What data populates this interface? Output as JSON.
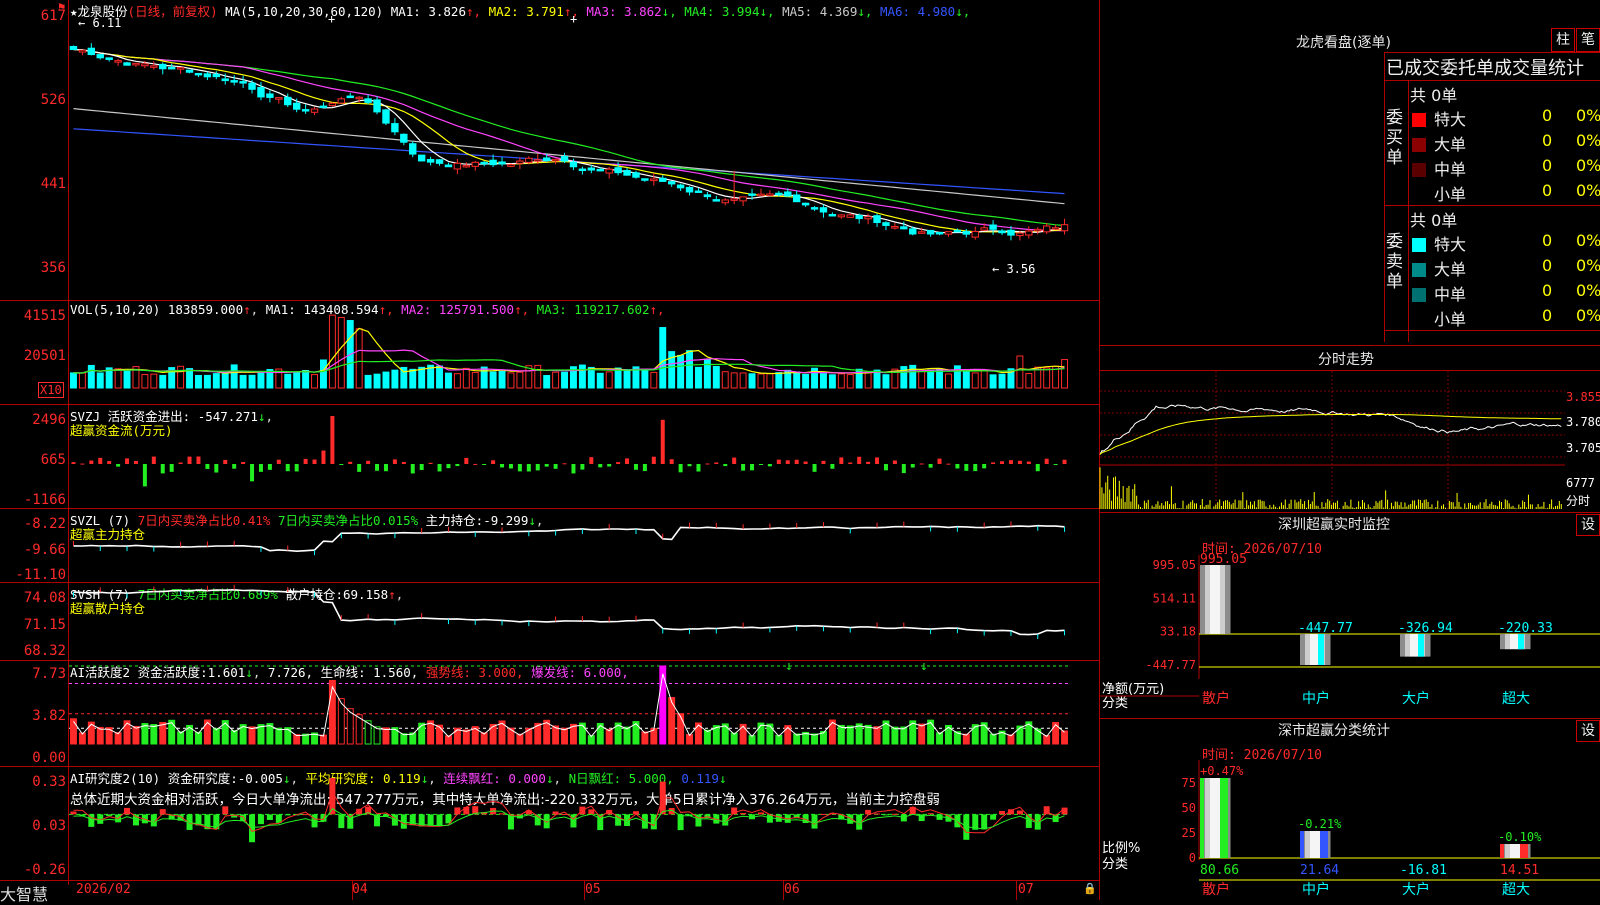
{
  "header": {
    "star": "★",
    "stock_name": "龙泉股份",
    "period": "(日线，前复权)",
    "ma_label": "MA(5,10,20,30,60,120)",
    "ma_items": [
      {
        "label": "MA1:",
        "value": "3.826",
        "arrow": "↑",
        "color": "#ffffff"
      },
      {
        "label": "MA2:",
        "value": "3.791",
        "arrow": "↑",
        "color": "#ffff00"
      },
      {
        "label": "MA3:",
        "value": "3.862",
        "arrow": "↓",
        "color": "#ff44ff"
      },
      {
        "label": "MA4:",
        "value": "3.994",
        "arrow": "↓",
        "color": "#22ee22"
      },
      {
        "label": "MA5:",
        "value": "4.369",
        "arrow": "↓",
        "color": "#c8c8c8"
      },
      {
        "label": "MA6:",
        "value": "4.980",
        "arrow": "↓",
        "color": "#3355ff"
      }
    ],
    "high_label": "6.11",
    "low_label": "3.56"
  },
  "price_axis": [
    "617",
    "526",
    "441",
    "356"
  ],
  "vol": {
    "legend": "VOL(5,10,20)",
    "value": "183859.000",
    "items": [
      {
        "label": "MA1:",
        "value": "143408.594",
        "color": "#ffffff"
      },
      {
        "label": "MA2:",
        "value": "125791.500",
        "color": "#ff44ff"
      },
      {
        "label": "MA3:",
        "value": "119217.602",
        "color": "#22ee22"
      }
    ],
    "axis": [
      "41515",
      "20501"
    ],
    "unit": "X10"
  },
  "svzj": {
    "legend": "SVZJ  活跃资金进出:",
    "value": "-547.271",
    "sub": "超赢资金流(万元)",
    "axis": [
      "2496",
      "665",
      "-1166"
    ]
  },
  "svzl": {
    "name": "SVZL (7)",
    "p1": "7日内买卖净占比0.41%",
    "p2": "7日内买卖净占比0.015%",
    "p3": "主力持仓:",
    "p3v": "-9.299",
    "sub": "超赢主力持仓",
    "axis": [
      "-8.22",
      "-9.66",
      "-11.10"
    ]
  },
  "svsh": {
    "name": "SVSH (7)",
    "p1": "7日内买卖净占比0.689%",
    "p2": "散户持仓:",
    "p2v": "69.158",
    "sub": "超赢散户持仓",
    "axis": [
      "74.08",
      "71.15",
      "68.32"
    ]
  },
  "ai1": {
    "name": "AI活跃度2",
    "label": "资金活跃度:",
    "v1": "1.601",
    "v2": "7.726,",
    "life": "生命线: 1.560,",
    "strong": "强势线: 3.000,",
    "burst": "爆发线: 6.000,",
    "axis": [
      "7.73",
      "3.82",
      "0.00"
    ]
  },
  "ai2": {
    "name": "AI研究度2(10)",
    "label": "资金研究度:",
    "v1": "-0.005",
    "avg": "平均研究度: 0.119",
    "lian": "连续飘红: 0.000",
    "n": "N日飘红: 5.000,",
    "last": "0.119",
    "summary": "总体近期大资金相对活跃，今日大单净流出:-547.277万元，其中特大单净流出:-220.332万元，大单5日累计净入376.264万元，当前主力控盘弱",
    "axis": [
      "0.33",
      "0.03",
      "-0.26"
    ]
  },
  "date_axis": [
    "2026/02",
    "04",
    "05",
    "06",
    "07"
  ],
  "brand": "大智慧",
  "lhb": {
    "title": "龙虎看盘(逐单)",
    "btn1": "柱",
    "btn2": "笔",
    "header": "已成交委托单成交量统计",
    "buy_side": "委买单",
    "sell_side": "委卖单",
    "buy_total": "共 0单",
    "sell_total": "共 0单",
    "buy_rows": [
      {
        "label": "特大",
        "count": "0",
        "pct": "0%",
        "color": "#ff0000"
      },
      {
        "label": "大单",
        "count": "0",
        "pct": "0%",
        "color": "#8b0000"
      },
      {
        "label": "中单",
        "count": "0",
        "pct": "0%",
        "color": "#5a0000"
      },
      {
        "label": "小单",
        "count": "0",
        "pct": "0%",
        "color": "#000000"
      }
    ],
    "sell_rows": [
      {
        "label": "特大",
        "count": "0",
        "pct": "0%",
        "color": "#00ffff"
      },
      {
        "label": "大单",
        "count": "0",
        "pct": "0%",
        "color": "#008b8b"
      },
      {
        "label": "中单",
        "count": "0",
        "pct": "0%",
        "color": "#007070"
      },
      {
        "label": "小单",
        "count": "0",
        "pct": "0%",
        "color": "#000000"
      }
    ]
  },
  "intraday": {
    "title": "分时走势",
    "axis": [
      "3.855",
      "3.780",
      "3.705"
    ],
    "vol_label": "6777",
    "vol_unit": "分时"
  },
  "sz_monitor": {
    "title": "深圳超赢实时监控",
    "btn": "设",
    "time": "时间: 2026/07/10",
    "axis": [
      "995.05",
      "514.11",
      "33.18",
      "-447.77"
    ],
    "ylabel1": "净额(万元)",
    "ylabel2": "分类",
    "categories": [
      "散户",
      "中户",
      "大户",
      "超大"
    ],
    "values": [
      995.05,
      -447.77,
      -326.94,
      -220.33
    ],
    "labels": [
      "995.05",
      "-447.77",
      "-326.94",
      "-220.33"
    ]
  },
  "sz_class": {
    "title": "深市超赢分类统计",
    "btn": "设",
    "time": "时间: 2026/07/10",
    "axis": [
      "75",
      "50",
      "25",
      "0"
    ],
    "ylabel1": "比例%",
    "ylabel2": "分类",
    "categories": [
      "散户",
      "中户",
      "大户",
      "超大"
    ],
    "pct_labels": [
      "+0.47%",
      "-0.21%",
      "",
      "-0.10%"
    ],
    "values": [
      80.66,
      21.64,
      -16.81,
      14.51
    ],
    "value_labels": [
      "80.66",
      "21.64",
      "-16.81",
      "14.51"
    ]
  }
}
